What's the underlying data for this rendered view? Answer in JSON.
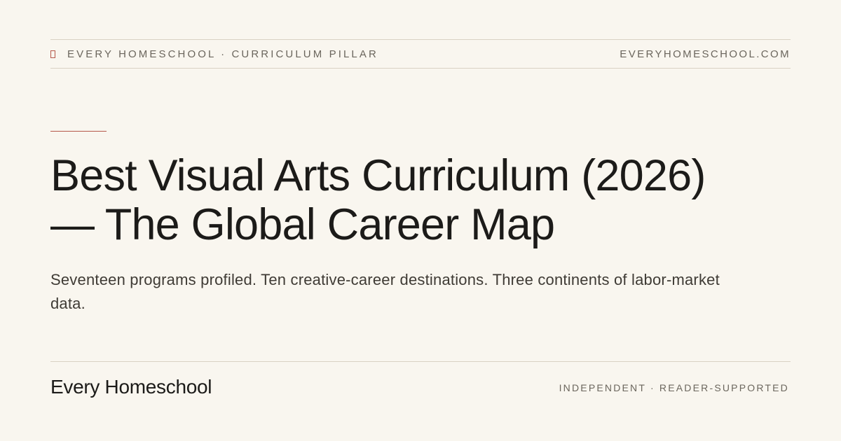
{
  "header": {
    "kicker": "EVERY HOMESCHOOL · CURRICULUM PILLAR",
    "domain": "EVERYHOMESCHOOL.COM",
    "mark_icon": "bookmark-icon"
  },
  "hero": {
    "headline_line1": "Best Visual Arts Curriculum (2026)",
    "headline_line2": "— The Global Career Map",
    "subhead": "Seventeen programs profiled. Ten creative-career destinations. Three continents of labor-market data."
  },
  "footer": {
    "brand": "Every Homeschool",
    "tagline": "INDEPENDENT · READER-SUPPORTED"
  },
  "colors": {
    "background": "#f9f6ef",
    "accent": "#b5584a",
    "text": "#1c1b19",
    "muted": "#6b665d",
    "rule": "#d9d2c4"
  }
}
